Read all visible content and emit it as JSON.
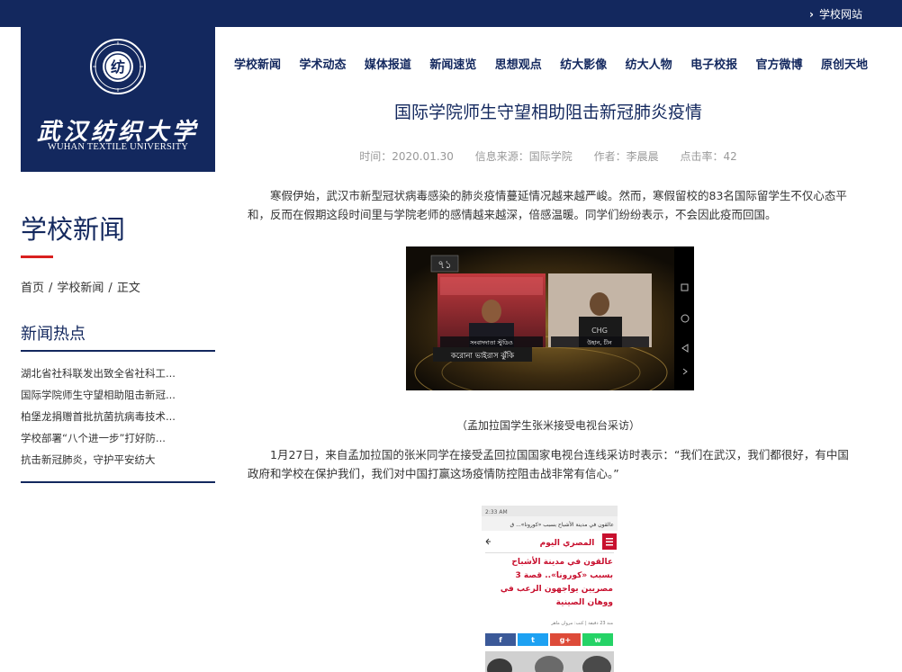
{
  "topbar": {
    "site_link": "学校网站"
  },
  "logo": {
    "cn_name": "武汉纺织大学",
    "en_name": "WUHAN TEXTILE UNIVERSITY",
    "seal_letter": "纺"
  },
  "nav": {
    "items": [
      "学校新闻",
      "学术动态",
      "媒体报道",
      "新闻速览",
      "思想观点",
      "纺大影像",
      "纺大人物",
      "电子校报",
      "官方微博",
      "原创天地"
    ]
  },
  "sidebar": {
    "section_title": "学校新闻",
    "breadcrumb": [
      "首页",
      "学校新闻",
      "正文"
    ],
    "breadcrumb_sep": "/",
    "hot_title": "新闻热点",
    "hot_items": [
      "湖北省社科联发出致全省社科工...",
      "国际学院师生守望相助阻击新冠...",
      "柏堡龙捐赠首批抗菌抗病毒技术...",
      "学校部署“八个进一步”打好防...",
      "抗击新冠肺炎，守护平安纺大"
    ]
  },
  "article": {
    "title": "国际学院师生守望相助阻击新冠肺炎疫情",
    "meta": {
      "time": "时间：2020.01.30",
      "source": "信息来源：国际学院",
      "author": "作者：李晨晨",
      "clicks": "点击率：42"
    },
    "para1": "寒假伊始，武汉市新型冠状病毒感染的肺炎疫情蔓延情况越来越严峻。然而，寒假留校的83名国际留学生不仅心态平和，反而在假期这段时间里与学院老师的感情越来越深，倍感温暖。同学们纷纷表示，不会因此疫而回国。",
    "image1": {
      "channel_logo": "৭১",
      "name1": "সংবাদদাতা স্টুডিও",
      "name2": "উহান, চীন",
      "banner": "করোনা ভাইরাস ঝুঁকি",
      "cap_letters": "CHG"
    },
    "caption1": "（孟加拉国学生张米接受电视台采访）",
    "para2": "1月27日，来自孟加拉国的张米同学在接受孟回拉国国家电视台连线采访时表示：“我们在武汉，我们都很好，有中国政府和学校在保护我们，我们对中国打赢这场疫情防控阻击战非常有信心。”",
    "image2": {
      "status_time": "2:33 AM",
      "url_text": "عالقون في مدينة الأشباح بسبب «كورونا»... ق",
      "brand": "المصري اليوم",
      "headline": "عالقون في مدينة الأشباح بسبب «كورونا».. قصة 3 مصريين يواجهون الرعب في ووهان الصينية",
      "byline": "منذ 23 دقيقة | كتب: مروان ماهر",
      "share_labels": [
        "f",
        "t",
        "g+",
        "w"
      ]
    }
  },
  "colors": {
    "navy": "#13285e",
    "red": "#d9201f",
    "meta_gray": "#999999"
  }
}
